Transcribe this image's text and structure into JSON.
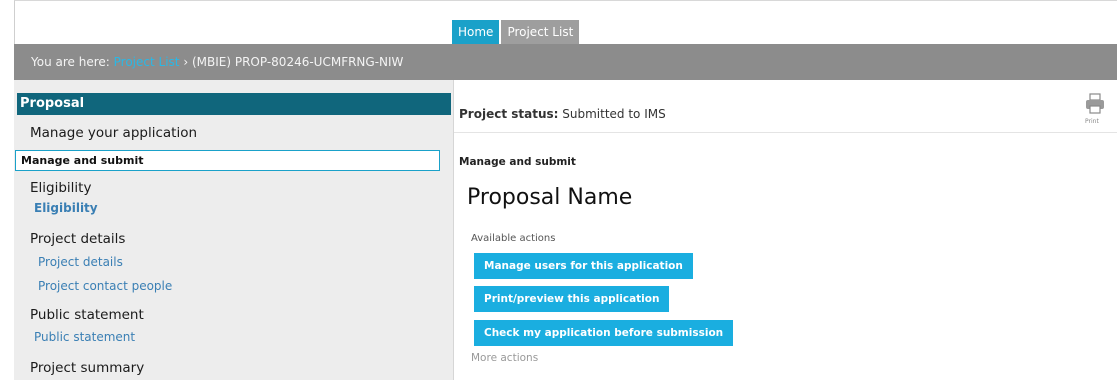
{
  "tabs": {
    "home": "Home",
    "project_list": "Project List"
  },
  "breadcrumb": {
    "prefix": "You are here:",
    "link": "Project List",
    "separator": "›",
    "current": "(MBIE) PROP-80246-UCMFRNG-NIW"
  },
  "sidebar": {
    "header": "Proposal",
    "sections": {
      "manage": {
        "title": "Manage your application",
        "items": [
          "Manage and submit"
        ]
      },
      "eligibility": {
        "title": "Eligibility",
        "items": [
          "Eligibility"
        ]
      },
      "project_details": {
        "title": "Project details",
        "items": [
          "Project details",
          "Project contact people"
        ]
      },
      "public_statement": {
        "title": "Public statement",
        "items": [
          "Public statement"
        ]
      },
      "project_summary": {
        "title": "Project summary"
      }
    }
  },
  "main": {
    "status_label": "Project status:",
    "status_value": "Submitted to IMS",
    "print_label": "Print",
    "section_label": "Manage and submit",
    "proposal_name": "Proposal Name",
    "available_actions": "Available actions",
    "actions": [
      "Manage users for this application",
      "Print/preview this application",
      "Check my application before submission"
    ],
    "more_actions": "More actions"
  },
  "colors": {
    "accent": "#1aaee0",
    "sidebar_header": "#10667c",
    "breadcrumb_bar": "#8c8c8c",
    "sidebar_bg": "#ededed",
    "link": "#3a7fb4"
  },
  "icons": {
    "print": "printer-icon"
  }
}
